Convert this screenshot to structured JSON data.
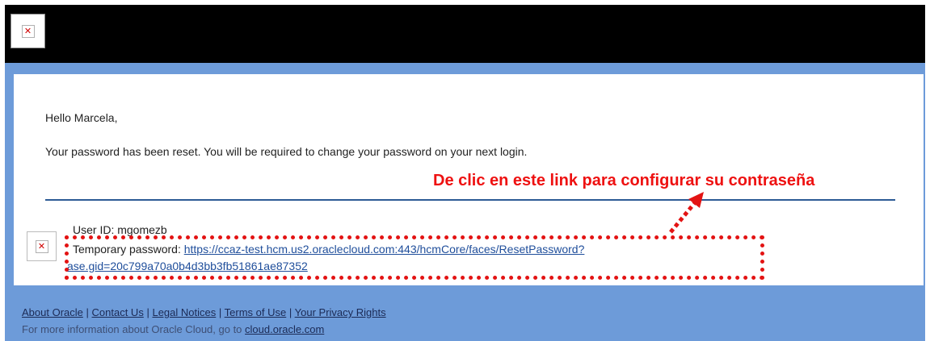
{
  "header": {
    "logo_icon": "broken-image-icon",
    "bg_color": "#000000"
  },
  "email": {
    "greeting": "Hello Marcela,",
    "message": "Your password has been reset. You will be required to change your password on your next login.",
    "user_id": "User ID: mgomezb",
    "temp_password_label": "Temporary password:",
    "reset_link_line1": "https://ccaz-test.hcm.us2.oraclecloud.com:443/hcmCore/faces/ResetPassword?",
    "reset_link_line2": "ase.gid=20c799a70a0b4d3bb3fb51861ae87352",
    "icon": "broken-image-icon"
  },
  "annotation": {
    "text": "De clic en este link para configurar su contraseña",
    "color": "#ee1111"
  },
  "footer": {
    "links": [
      "About Oracle",
      "Contact Us",
      "Legal Notices",
      "Terms of Use",
      "Your Privacy Rights"
    ],
    "separator": "|",
    "info_text": "For more information about Oracle Cloud, go to",
    "info_link": "cloud.oracle.com",
    "bg_color": "#6d9bd9"
  },
  "colors": {
    "divider": "#2c5a95",
    "link": "#1f4e9b"
  }
}
